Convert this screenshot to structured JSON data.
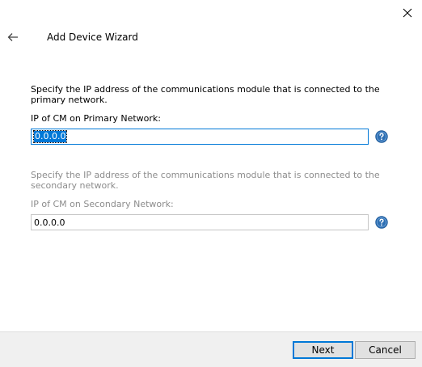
{
  "window": {
    "title": "Add Device Wizard"
  },
  "primary": {
    "description": "Specify the IP address of the communications module that is connected to the primary network.",
    "label": "IP of CM on Primary Network:",
    "value": "0.0.0.0",
    "help_icon": "help-icon"
  },
  "secondary": {
    "description": "Specify the IP address of the communications module that is connected to the secondary network.",
    "label": "IP of CM on Secondary Network:",
    "value": "0.0.0.0",
    "help_icon": "help-icon"
  },
  "footer": {
    "next_label": "Next",
    "cancel_label": "Cancel"
  },
  "colors": {
    "accent": "#0078d7",
    "help_icon": "#2d6fb3",
    "disabled_text": "#8c8c8c",
    "footer_bg": "#f0f0f0"
  }
}
